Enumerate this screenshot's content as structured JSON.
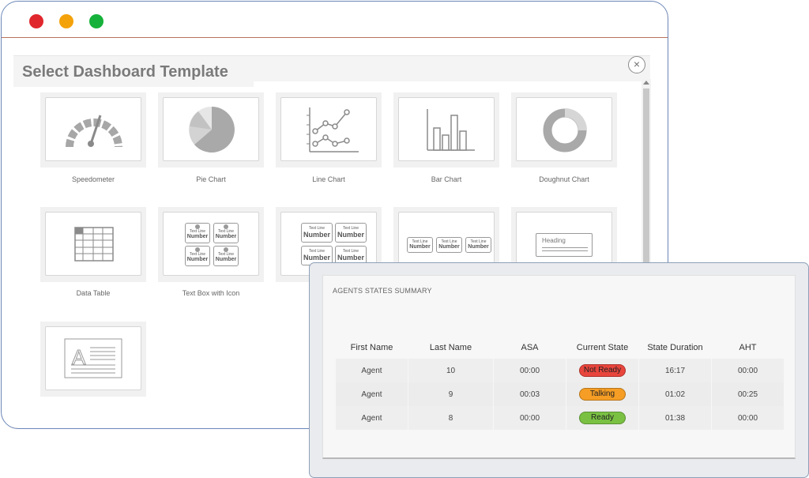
{
  "modal": {
    "title": "Select Dashboard Template",
    "close_symbol": "×"
  },
  "templates": [
    {
      "label": "Speedometer",
      "icon": "speedometer-icon"
    },
    {
      "label": "Pie Chart",
      "icon": "pie-chart-icon"
    },
    {
      "label": "Line Chart",
      "icon": "line-chart-icon"
    },
    {
      "label": "Bar Chart",
      "icon": "bar-chart-icon"
    },
    {
      "label": "Doughnut Chart",
      "icon": "doughnut-chart-icon"
    },
    {
      "label": "Data Table",
      "icon": "data-table-icon"
    },
    {
      "label": "Text Box with Icon",
      "icon": "text-box-with-icon-preview"
    },
    {
      "label": "",
      "icon": "text-box-grid-preview"
    },
    {
      "label": "",
      "icon": "text-box-row-preview"
    },
    {
      "label": "",
      "icon": "heading-preview"
    },
    {
      "label": "",
      "icon": "text-block-icon"
    }
  ],
  "previews": {
    "text_line": "Text Line",
    "number": "Number",
    "heading": "Heading"
  },
  "summary": {
    "title": "AGENTS STATES SUMMARY",
    "columns": [
      "First Name",
      "Last Name",
      "ASA",
      "Current State",
      "State Duration",
      "AHT"
    ],
    "rows": [
      {
        "first": "Agent",
        "last": "10",
        "asa": "00:00",
        "state": "Not Ready",
        "duration": "16:17",
        "aht": "00:00"
      },
      {
        "first": "Agent",
        "last": "9",
        "asa": "00:03",
        "state": "Talking",
        "duration": "01:02",
        "aht": "00:25"
      },
      {
        "first": "Agent",
        "last": "8",
        "asa": "00:00",
        "state": "Ready",
        "duration": "01:38",
        "aht": "00:00"
      }
    ]
  },
  "colors": {
    "not_ready": "#e8453c",
    "talking": "#f59d24",
    "ready": "#7ac143",
    "close_red": "#e0272c",
    "minimize_yellow": "#f4a20a",
    "maximize_green": "#16b13a"
  }
}
